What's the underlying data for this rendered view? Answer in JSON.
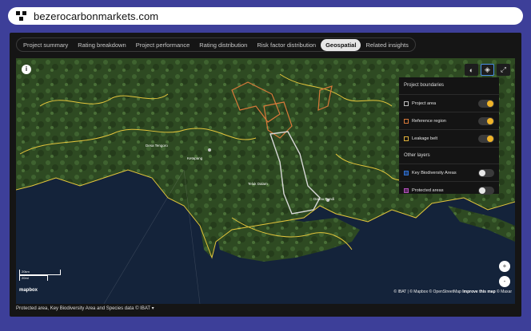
{
  "browser": {
    "url": "bezerocarbonmarkets.com"
  },
  "tabs": [
    {
      "label": "Project summary",
      "active": false
    },
    {
      "label": "Rating breakdown",
      "active": false
    },
    {
      "label": "Project performance",
      "active": false
    },
    {
      "label": "Rating distribution",
      "active": false
    },
    {
      "label": "Risk factor distribution",
      "active": false
    },
    {
      "label": "Geospatial",
      "active": true
    },
    {
      "label": "Related insights",
      "active": false
    }
  ],
  "map": {
    "info_icon": "info-icon",
    "tools": [
      "map-style-icon",
      "layers-icon",
      "expand-icon"
    ],
    "labels": [
      "Desa Tengoro",
      "Ketapang",
      "Teluk Dalam",
      "Danau Pundi"
    ],
    "scale": {
      "km": "20km",
      "mi": "20mi"
    },
    "brand": "mapbox",
    "attribution": "© IBAT | © Mapbox © OpenStreetMap",
    "improve": "Improve this map",
    "maxar": "© Maxar",
    "zoom_in": "+",
    "zoom_out": "-"
  },
  "layers": {
    "project_boundaries_title": "Project boundaries",
    "other_layers_title": "Other layers",
    "project_boundaries": [
      {
        "label": "Project area",
        "color": "#bdbdbd",
        "on": true
      },
      {
        "label": "Reference region",
        "color": "#d9793a",
        "on": true
      },
      {
        "label": "Leakage belt",
        "color": "#e0b13a",
        "on": true
      }
    ],
    "other_layers": [
      {
        "label": "Key Biodiversity Areas",
        "color": "#2f6fd0",
        "on": false
      },
      {
        "label": "Protected areas",
        "color": "#b04fb8",
        "on": false
      }
    ]
  },
  "footer": {
    "text": "Protected area, Key Biodiversity Area and Species data © IBAT ▾"
  }
}
